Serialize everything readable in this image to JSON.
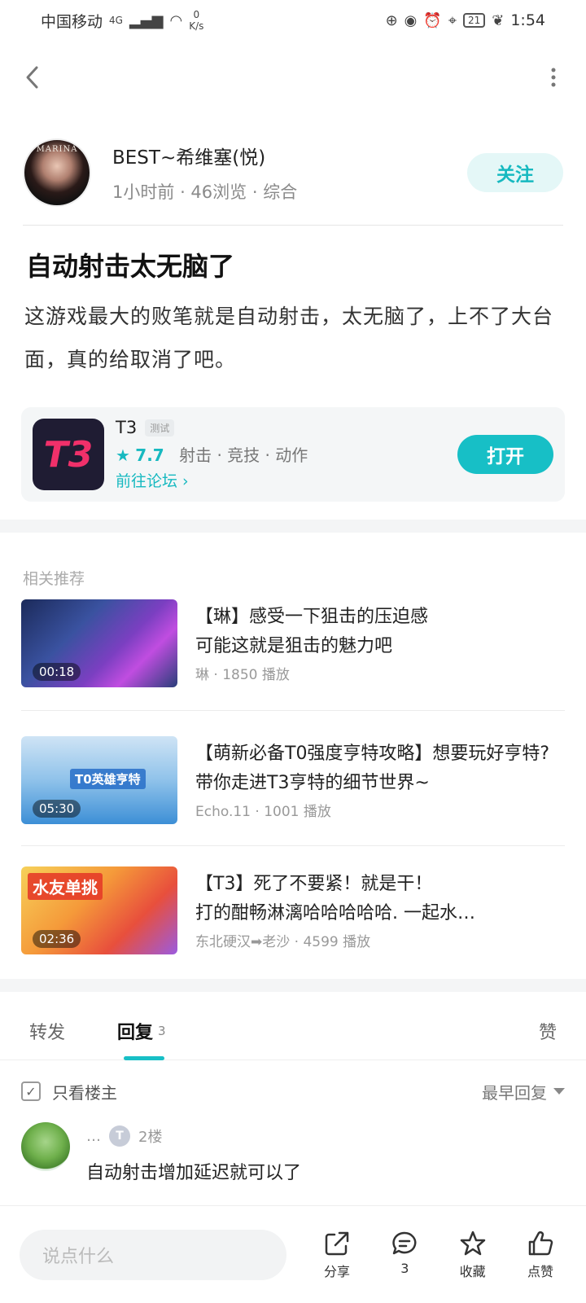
{
  "status_bar": {
    "carrier": "中国移动",
    "signal_label": "4G",
    "net_speed_value": "0",
    "net_speed_unit": "K/s",
    "battery": "21",
    "time": "1:54"
  },
  "author": {
    "avatar_text": "MARINA",
    "name": "BEST~希维塞(悦)",
    "time": "1小时前",
    "views": "46浏览",
    "category": "综合",
    "follow_label": "关注"
  },
  "post": {
    "title": "自动射击太无脑了",
    "body": "这游戏最大的败笔就是自动射击，太无脑了，上不了大台面，真的给取消了吧。"
  },
  "game_card": {
    "logo_text": "T3",
    "name": "T3",
    "tag": "测试",
    "rating": "7.7",
    "tags": [
      "射击",
      "竞技",
      "动作"
    ],
    "forum_link": "前往论坛 ›",
    "open_label": "打开"
  },
  "recommendations": {
    "label": "相关推荐",
    "items": [
      {
        "title": "【琳】感受一下狙击的压迫感\n可能这就是狙击的魅力吧",
        "author": "琳",
        "plays": "1850 播放",
        "duration": "00:18",
        "overlay": ""
      },
      {
        "title": "【萌新必备T0强度亨特攻略】想要玩好亨特?带你走进T3亨特的细节世界~",
        "author": "Echo.11",
        "plays": "1001 播放",
        "duration": "05:30",
        "overlay": "T0英雄亨特"
      },
      {
        "title": "【T3】死了不要紧！就是干！\n打的酣畅淋漓哈哈哈哈哈. 一起水…",
        "author": "东北硬汉➡老沙",
        "plays": "4599 播放",
        "duration": "02:36",
        "overlay": "水友单挑"
      }
    ]
  },
  "tabs": {
    "repost": "转发",
    "reply": "回复",
    "reply_count": "3",
    "likes": "赞"
  },
  "filter": {
    "only_op": "只看楼主",
    "sort": "最早回复"
  },
  "comment": {
    "name": "…",
    "badge": "T",
    "floor": "2楼",
    "text": "自动射击增加延迟就可以了"
  },
  "bottom_bar": {
    "input_placeholder": "说点什么",
    "share": "分享",
    "comments": "3",
    "favorite": "收藏",
    "like": "点赞"
  },
  "colors": {
    "accent": "#17bfc6",
    "follow_bg": "#e4f7f7"
  }
}
